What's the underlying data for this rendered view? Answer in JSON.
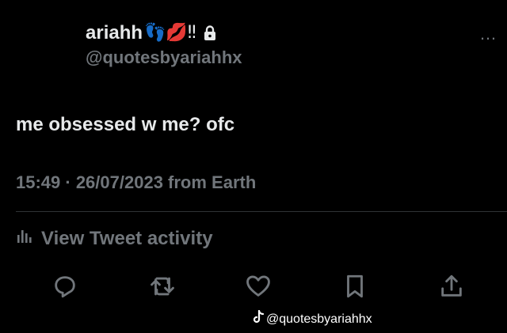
{
  "tweet": {
    "display_name": "ariahh",
    "name_emojis": "👣💋‼",
    "handle": "@quotesbyariahhx",
    "more_icon": "…",
    "text": "me obsessed w me? ofc",
    "meta": "15:49 · 26/07/2023 from Earth",
    "activity_label": "View Tweet activity"
  },
  "actions": {
    "reply": "reply-icon",
    "retweet": "retweet-icon",
    "like": "like-icon",
    "bookmark": "bookmark-icon",
    "share": "share-icon"
  },
  "watermark": {
    "logo": "tiktok-icon",
    "text": "@quotesbyariahhx"
  },
  "colors": {
    "background": "#000000",
    "primary_text": "#e7e9ea",
    "secondary_text": "#71767b",
    "divider": "#2f3336"
  }
}
